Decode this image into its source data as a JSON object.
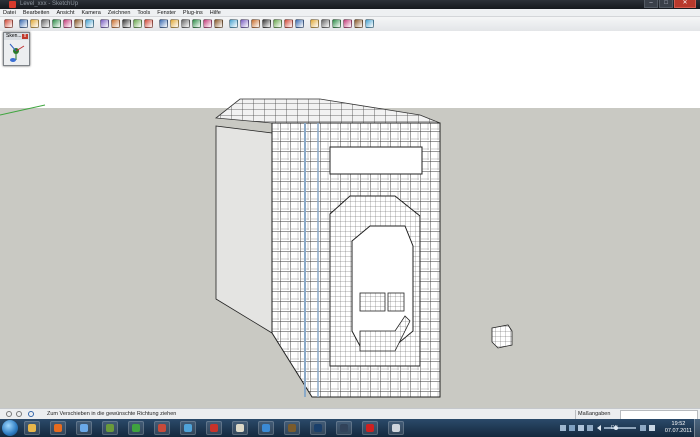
{
  "window": {
    "title": "Level_xxx - SketchUp",
    "buttons": {
      "minimize": "–",
      "maximize": "□",
      "close": "✕"
    }
  },
  "menu": [
    "Datei",
    "Bearbeiten",
    "Ansicht",
    "Kamera",
    "Zeichnen",
    "Tools",
    "Fenster",
    "Plug-ins",
    "Hilfe"
  ],
  "toolbar": {
    "icons": [
      "select-tool-icon",
      "rectangle-tool-icon",
      "circle-tool-icon",
      "arc-tool-icon",
      "line-tool-icon",
      "eraser-tool-icon",
      "paint-bucket-icon",
      "push-pull-icon",
      "offset-icon",
      "move-tool-icon",
      "rotate-tool-icon",
      "follow-me-icon",
      "scale-tool-icon",
      "tape-measure-icon",
      "dimension-icon",
      "protractor-icon",
      "text-tool-icon",
      "axes-tool-icon",
      "3d-text-icon",
      "orbit-icon",
      "pan-icon",
      "zoom-icon",
      "zoom-window-icon",
      "zoom-extents-icon",
      "previous-view-icon",
      "next-view-icon",
      "get-models-icon",
      "share-model-icon",
      "components-icon",
      "styles-icon",
      "layers-icon",
      "google-earth-icon"
    ]
  },
  "palette": {
    "title": "Sken...",
    "close": "x"
  },
  "status": {
    "message": "Zum Verschieben in die gewünschte Richtung ziehen",
    "measure_label": "Maßangaben",
    "icons": [
      "geo-location-icon",
      "credits-icon",
      "help-icon"
    ]
  },
  "taskbar": {
    "apps": [
      {
        "name": "explorer",
        "color": "#e8b64a"
      },
      {
        "name": "firefox",
        "color": "#e66b1f"
      },
      {
        "name": "itunes",
        "color": "#6aa9e9"
      },
      {
        "name": "minecraft",
        "color": "#6a9a3a"
      },
      {
        "name": "media-player",
        "color": "#3fa33f"
      },
      {
        "name": "sketchup",
        "color": "#c84a3a"
      },
      {
        "name": "paint",
        "color": "#4fa3d9"
      },
      {
        "name": "filezilla",
        "color": "#c8322a"
      },
      {
        "name": "notes",
        "color": "#ddd9c8"
      },
      {
        "name": "globe",
        "color": "#3b8ad4"
      },
      {
        "name": "game",
        "color": "#7a5b2c"
      },
      {
        "name": "photoshop",
        "color": "#1a3f6b"
      },
      {
        "name": "steam",
        "color": "#32435a"
      },
      {
        "name": "opera",
        "color": "#d02020"
      },
      {
        "name": "editor",
        "color": "#cfd5dc"
      }
    ],
    "language": "DE",
    "time": "19:52",
    "date": "07.07.2011"
  }
}
